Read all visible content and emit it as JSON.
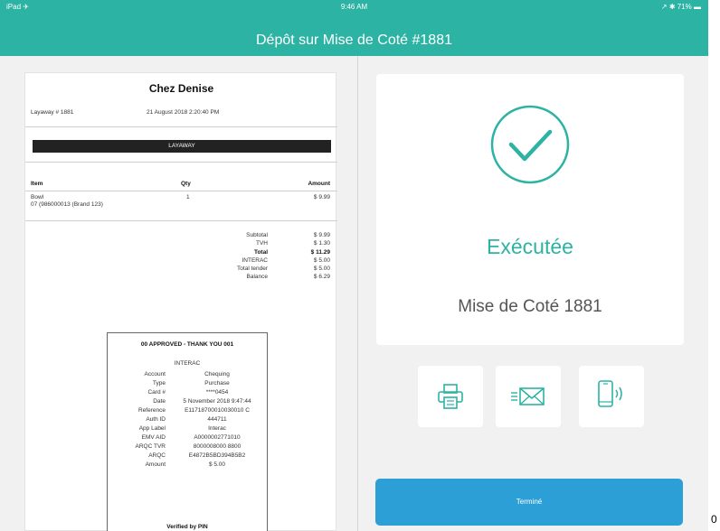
{
  "status_bar": {
    "carrier": "iPad ✈",
    "time": "9:46 AM",
    "battery": "↗ ✱ 71% ▬"
  },
  "header": {
    "title": "Dépôt sur Mise de Coté #1881"
  },
  "receipt": {
    "store_name": "Chez Denise",
    "layaway_number": "Layaway # 1881",
    "date": "21 August 2018 2:20:40 PM",
    "transaction_type": "LAYAWAY",
    "columns": {
      "item": "Item",
      "qty": "Qty",
      "amount": "Amount"
    },
    "item": {
      "name": "Bowl",
      "code": "07 (986000013 (Brand 123)",
      "qty": "1",
      "amount": "$ 9.99"
    },
    "totals": [
      {
        "label": "Subtotal",
        "value": "$ 9.99"
      },
      {
        "label": "TVH",
        "value": "$ 1.30"
      },
      {
        "label": "Total",
        "value": "$ 11.29"
      },
      {
        "label": "INTERAC",
        "value": "$ 5.00"
      },
      {
        "label": "Total tender",
        "value": "$ 5.00"
      },
      {
        "label": "Balance",
        "value": "$ 6.29"
      }
    ],
    "approval": {
      "title": "00 APPROVED - THANK YOU 001",
      "network": "INTERAC",
      "rows": [
        {
          "label": "Account",
          "value": "Chequing"
        },
        {
          "label": "Type",
          "value": "Purchase"
        },
        {
          "label": "Card #",
          "value": "****0454"
        },
        {
          "label": "Date",
          "value": "5 November 2018 9:47:44"
        },
        {
          "label": "Reference",
          "value": "E11718700010030010 C"
        },
        {
          "label": "Auth ID",
          "value": "444711"
        },
        {
          "label": "App Label",
          "value": "Interac"
        },
        {
          "label": "EMV AID",
          "value": "A0000002771010"
        },
        {
          "label": "ARQC TVR",
          "value": "8000008000 8800"
        },
        {
          "label": "ARQC",
          "value": "E4872B5BD394B5B2"
        },
        {
          "label": "Amount",
          "value": "$ 5.00"
        }
      ],
      "verified": "Verified by PIN"
    }
  },
  "result": {
    "status": "Exécutée",
    "subtitle": "Mise de Coté 1881"
  },
  "actions": {
    "print_icon": "printer-icon",
    "email_icon": "email-icon",
    "sms_icon": "phone-signal-icon"
  },
  "done_button": {
    "label": "Terminé"
  },
  "stray_text": "0",
  "colors": {
    "accent": "#2cb3a3",
    "button": "#2b9fd6"
  }
}
